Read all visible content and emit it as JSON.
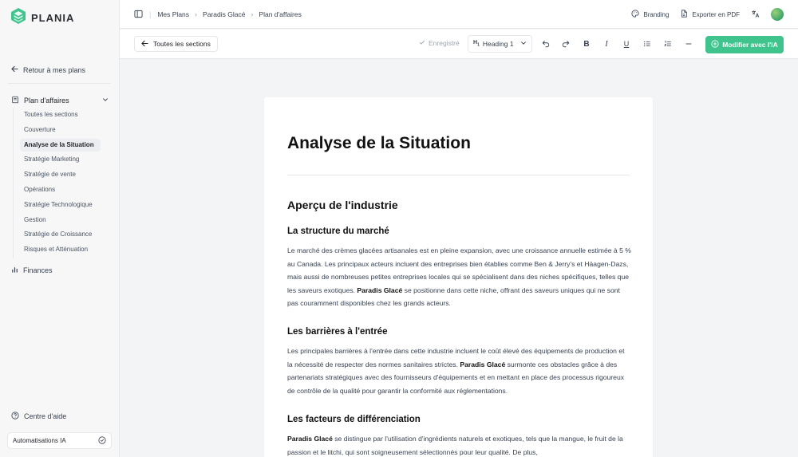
{
  "brand": {
    "name": "PLANIA",
    "accent": "#3ec48c"
  },
  "sidebar": {
    "back_label": "Retour à mes plans",
    "section_label": "Plan d'affaires",
    "items": [
      {
        "label": "Toutes les sections"
      },
      {
        "label": "Couverture"
      },
      {
        "label": "Analyse de la Situation",
        "active": true
      },
      {
        "label": "Stratégie Marketing"
      },
      {
        "label": "Stratégie de vente"
      },
      {
        "label": "Opérations"
      },
      {
        "label": "Stratégie Technologique"
      },
      {
        "label": "Gestion"
      },
      {
        "label": "Stratégie de Croissance"
      },
      {
        "label": "Risques et Atténuation"
      }
    ],
    "finances_label": "Finances",
    "help_label": "Centre d'aide",
    "automation_label": "Automatisations IA"
  },
  "breadcrumb": [
    "Mes Plans",
    "Paradis Glacé",
    "Plan d'affaires"
  ],
  "topbar": {
    "branding_label": "Branding",
    "export_label": "Exporter en PDF"
  },
  "toolbar": {
    "all_sections_label": "Toutes les sections",
    "saved_label": "Enregistré",
    "heading_value": "Heading 1",
    "ai_label": "Modifier avec l'IA"
  },
  "document": {
    "title": "Analyse de la Situation",
    "h2": "Aperçu de l'industrie",
    "sections": [
      {
        "heading": "La structure du marché",
        "text_before": "Le marché des crèmes glacées artisanales est en pleine expansion, avec une croissance annuelle estimée à 5 % au Canada. Les principaux acteurs incluent des entreprises bien établies comme Ben & Jerry's et Häagen-Dazs, mais aussi de nombreuses petites entreprises locales qui se spécialisent dans des niches spécifiques, telles que les saveurs exotiques. ",
        "bold": "Paradis Glacé",
        "text_after": " se positionne dans cette niche, offrant des saveurs uniques qui ne sont pas couramment disponibles chez les grands acteurs."
      },
      {
        "heading": "Les barrières à l'entrée",
        "text_before": "Les principales barrières à l'entrée dans cette industrie incluent le coût élevé des équipements de production et la nécessité de respecter des normes sanitaires strictes. ",
        "bold": "Paradis Glacé",
        "text_after": " surmonte ces obstacles grâce à des partenariats stratégiques avec des fournisseurs d'équipements et en mettant en place des processus rigoureux de contrôle de la qualité pour garantir la conformité aux réglementations."
      },
      {
        "heading": "Les facteurs de différenciation",
        "text_before": "",
        "bold": "Paradis Glacé",
        "text_after": " se distingue par l'utilisation d'ingrédients naturels et exotiques, tels que la mangue, le fruit de la passion et le litchi, qui sont soigneusement sélectionnés pour leur qualité. De plus,"
      }
    ]
  }
}
